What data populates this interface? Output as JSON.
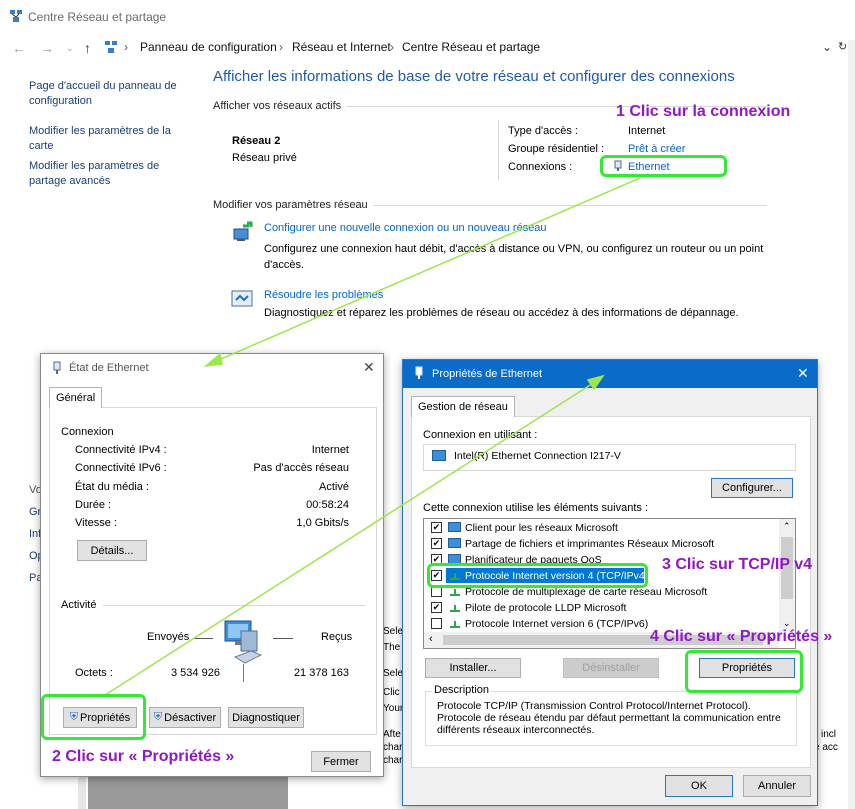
{
  "main_window": {
    "title": "Centre Réseau et partage",
    "breadcrumb": [
      "Panneau de configuration",
      "Réseau et Internet",
      "Centre Réseau et partage"
    ],
    "left_nav": [
      "Page d'accueil du panneau de configuration",
      "Modifier les paramètres de la carte",
      "Modifier les paramètres de partage avancés"
    ],
    "left_nav_cut": [
      "Vo",
      "Gr",
      "Inf",
      "Op",
      "Pa"
    ],
    "heading": "Afficher les informations de base de votre réseau et configurer des connexions",
    "active_networks_label": "Afficher vos réseaux actifs",
    "network_name": "Réseau 2",
    "network_type": "Réseau privé",
    "access_type_label": "Type d'accès :",
    "access_type_value": "Internet",
    "homegroup_label": "Groupe résidentiel :",
    "homegroup_value": "Prêt à créer",
    "connections_label": "Connexions :",
    "connections_value": "Ethernet",
    "modify_label": "Modifier vos paramètres réseau",
    "task1_link": "Configurer une nouvelle connexion ou un nouveau réseau",
    "task1_desc": "Configurez une connexion haut débit, d'accès à distance ou VPN, ou configurez un routeur ou un point d'accès.",
    "task2_link": "Résoudre les problèmes",
    "task2_desc": "Diagnostiquez et réparez les problèmes de réseau ou accédez à des informations de dépannage.",
    "bg_fragments": [
      "Sele",
      "The",
      "Sele",
      "Clic",
      "Your",
      "Afte",
      "char",
      "char",
      "incl",
      "e acc"
    ]
  },
  "status_dialog": {
    "title": "État de Ethernet",
    "tab": "Général",
    "connection_group": "Connexion",
    "rows": [
      {
        "label": "Connectivité IPv4 :",
        "value": "Internet"
      },
      {
        "label": "Connectivité IPv6 :",
        "value": "Pas d'accès réseau"
      },
      {
        "label": "État du média :",
        "value": "Activé"
      },
      {
        "label": "Durée :",
        "value": "00:58:24"
      },
      {
        "label": "Vitesse :",
        "value": "1,0 Gbits/s"
      }
    ],
    "details_button": "Détails...",
    "activity_group": "Activité",
    "sent_label": "Envoyés",
    "received_label": "Reçus",
    "bytes_label": "Octets :",
    "bytes_sent": "3 534 926",
    "bytes_received": "21 378 163",
    "properties_button": "Propriétés",
    "disable_button": "Désactiver",
    "diagnose_button": "Diagnostiquer",
    "close_button": "Fermer"
  },
  "props_dialog": {
    "title": "Propriétés de Ethernet",
    "tab": "Gestion de réseau",
    "connect_using_label": "Connexion en utilisant :",
    "adapter": "Intel(R) Ethernet Connection I217-V",
    "configure_button": "Configurer...",
    "items_label": "Cette connexion utilise les éléments suivants :",
    "items": [
      {
        "label": "Client pour les réseaux Microsoft",
        "checked": "✔"
      },
      {
        "label": "Partage de fichiers et imprimantes Réseaux Microsoft",
        "checked": "✔"
      },
      {
        "label": "Planificateur de paquets QoS",
        "checked": "✔"
      },
      {
        "label": "Protocole Internet version 4 (TCP/IPv4)",
        "checked": "✔"
      },
      {
        "label": "Protocole de multiplexage de carte réseau Microsoft",
        "checked": ""
      },
      {
        "label": "Pilote de protocole LLDP Microsoft",
        "checked": "✔"
      },
      {
        "label": "Protocole Internet version 6 (TCP/IPv6)",
        "checked": ""
      }
    ],
    "install_button": "Installer...",
    "uninstall_button": "Désinstaller",
    "properties_button": "Propriétés",
    "description_label": "Description",
    "description": "Protocole TCP/IP (Transmission Control Protocol/Internet Protocol). Protocole de réseau étendu par défaut permettant la communication entre différents réseaux interconnectés.",
    "ok_button": "OK",
    "cancel_button": "Annuler"
  },
  "annotations": {
    "step1": "1 Clic sur la connexion",
    "step2": "2 Clic sur « Propriétés »",
    "step3": "3 Clic sur TCP/IP v4",
    "step4": "4 Clic sur « Propriétés »"
  },
  "colors": {
    "link": "#0066cc",
    "heading": "#1e5aa8",
    "annotation": "#8f17c7",
    "highlight_box": "#34e834",
    "arrow": "#9be84a",
    "props_titlebar": "#0a6bc9",
    "selected_item": "#0078d7"
  }
}
